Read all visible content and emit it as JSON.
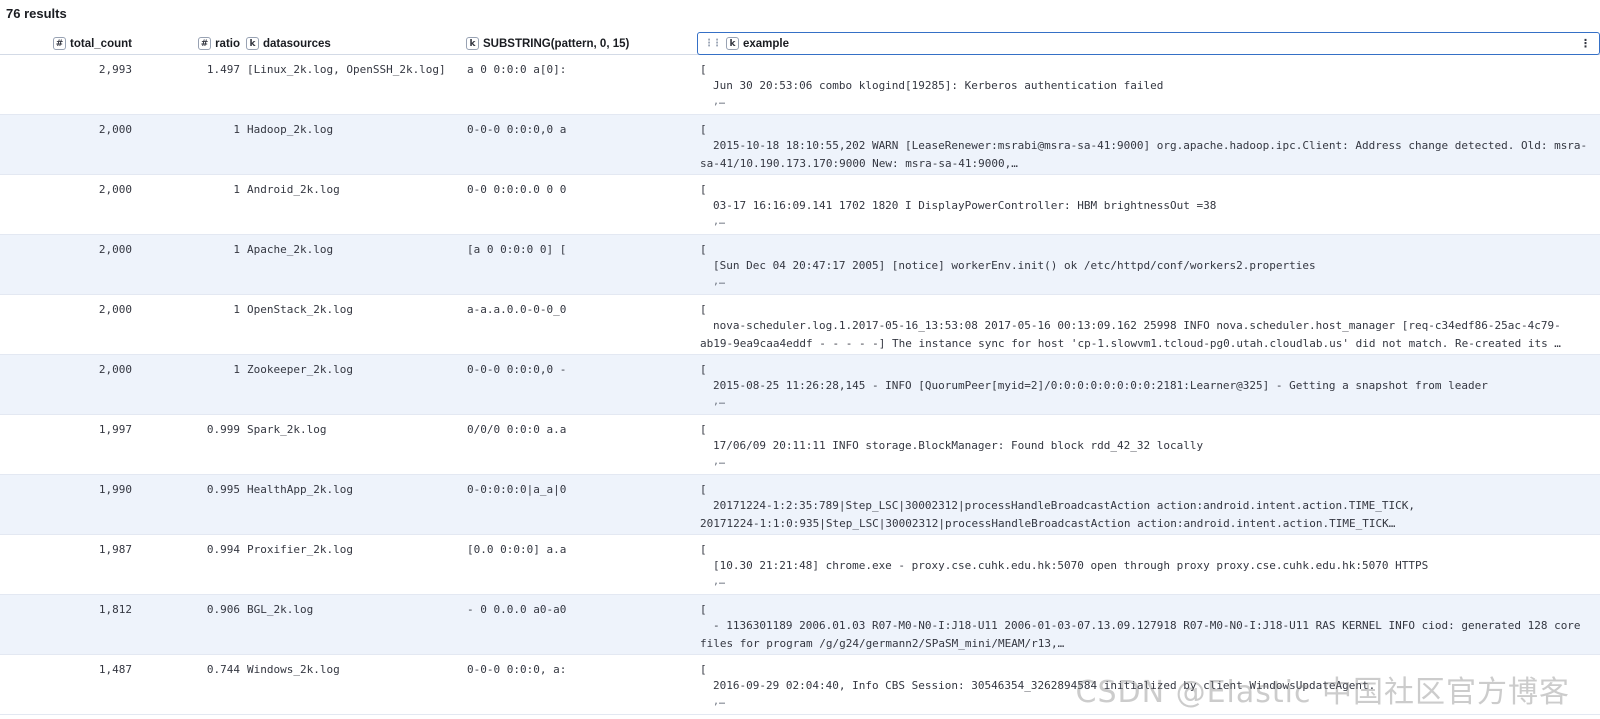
{
  "results": "76 results",
  "columns": [
    {
      "label": "total_count",
      "type": "#"
    },
    {
      "label": "ratio",
      "type": "#"
    },
    {
      "label": "datasources",
      "type": "k"
    },
    {
      "label": "SUBSTRING(pattern, 0, 15)",
      "type": "k"
    },
    {
      "label": "example",
      "type": "k"
    }
  ],
  "icons": {
    "drag": "drag-handle-icon",
    "menu": "kebab-menu-icon"
  },
  "rows": [
    {
      "total_count": "2,993",
      "ratio": "1.497",
      "datasources": "[Linux_2k.log, OpenSSH_2k.log]",
      "substring": "a 0 0:0:0 a[0]:",
      "open": "[",
      "example": [
        "Jun 30 20:53:06 combo klogind[19285]: Kerberos authentication failed"
      ],
      "tail": ",…"
    },
    {
      "total_count": "2,000",
      "ratio": "1",
      "datasources": "Hadoop_2k.log",
      "substring": "0-0-0 0:0:0,0 a",
      "open": "[",
      "example": [
        "2015-10-18 18:10:55,202 WARN [LeaseRenewer:msrabi@msra-sa-41:9000] org.apache.hadoop.ipc.Client: Address change detected. Old: msra-",
        "sa-41/10.190.173.170:9000 New: msra-sa-41:9000,…"
      ],
      "tail": ""
    },
    {
      "total_count": "2,000",
      "ratio": "1",
      "datasources": "Android_2k.log",
      "substring": "0-0 0:0:0.0 0 0",
      "open": "[",
      "example": [
        "03-17 16:16:09.141  1702  1820 I DisplayPowerController: HBM brightnessOut =38"
      ],
      "tail": ",…"
    },
    {
      "total_count": "2,000",
      "ratio": "1",
      "datasources": "Apache_2k.log",
      "substring": "[a 0 0:0:0 0] [",
      "open": "[",
      "example": [
        "[Sun Dec 04 20:47:17 2005] [notice] workerEnv.init() ok /etc/httpd/conf/workers2.properties"
      ],
      "tail": ",…"
    },
    {
      "total_count": "2,000",
      "ratio": "1",
      "datasources": "OpenStack_2k.log",
      "substring": "a-a.a.0.0-0-0_0",
      "open": "[",
      "example": [
        "nova-scheduler.log.1.2017-05-16_13:53:08 2017-05-16 00:13:09.162 25998 INFO nova.scheduler.host_manager [req-c34edf86-25ac-4c79-",
        "ab19-9ea9caa4eddf - - - - -] The instance sync for host 'cp-1.slowvm1.tcloud-pg0.utah.cloudlab.us' did not match. Re-created its …"
      ],
      "tail": ""
    },
    {
      "total_count": "2,000",
      "ratio": "1",
      "datasources": "Zookeeper_2k.log",
      "substring": "0-0-0 0:0:0,0 -",
      "open": "[",
      "example": [
        "2015-08-25 11:26:28,145 - INFO  [QuorumPeer[myid=2]/0:0:0:0:0:0:0:0:2181:Learner@325] - Getting a snapshot from leader"
      ],
      "tail": ",…"
    },
    {
      "total_count": "1,997",
      "ratio": "0.999",
      "datasources": "Spark_2k.log",
      "substring": "0/0/0 0:0:0 a.a",
      "open": "[",
      "example": [
        "17/06/09 20:11:11 INFO storage.BlockManager: Found block rdd_42_32 locally"
      ],
      "tail": ",…"
    },
    {
      "total_count": "1,990",
      "ratio": "0.995",
      "datasources": "HealthApp_2k.log",
      "substring": "0-0:0:0:0|a_a|0",
      "open": "[",
      "example": [
        "20171224-1:2:35:789|Step_LSC|30002312|processHandleBroadcastAction action:android.intent.action.TIME_TICK,",
        "20171224-1:1:0:935|Step_LSC|30002312|processHandleBroadcastAction action:android.intent.action.TIME_TICK…"
      ],
      "tail": ""
    },
    {
      "total_count": "1,987",
      "ratio": "0.994",
      "datasources": "Proxifier_2k.log",
      "substring": "[0.0 0:0:0] a.a",
      "open": "[",
      "example": [
        "[10.30 21:21:48] chrome.exe - proxy.cse.cuhk.edu.hk:5070 open through proxy proxy.cse.cuhk.edu.hk:5070 HTTPS"
      ],
      "tail": ",…"
    },
    {
      "total_count": "1,812",
      "ratio": "0.906",
      "datasources": "BGL_2k.log",
      "substring": "- 0 0.0.0 a0-a0",
      "open": "[",
      "example": [
        "- 1136301189 2006.01.03 R07-M0-N0-I:J18-U11 2006-01-03-07.13.09.127918 R07-M0-N0-I:J18-U11 RAS KERNEL INFO ciod: generated 128 core",
        "files for program /g/g24/germann2/SPaSM_mini/MEAM/r13,…"
      ],
      "tail": ""
    },
    {
      "total_count": "1,487",
      "ratio": "0.744",
      "datasources": "Windows_2k.log",
      "substring": "0-0-0 0:0:0, a:",
      "open": "[",
      "example": [
        "2016-09-29 02:04:40, Info                  CBS    Session: 30546354_3262894584 initialized by client WindowsUpdateAgent."
      ],
      "tail": ",…"
    }
  ],
  "watermark": "CSDN @Elastic 中国社区官方博客"
}
